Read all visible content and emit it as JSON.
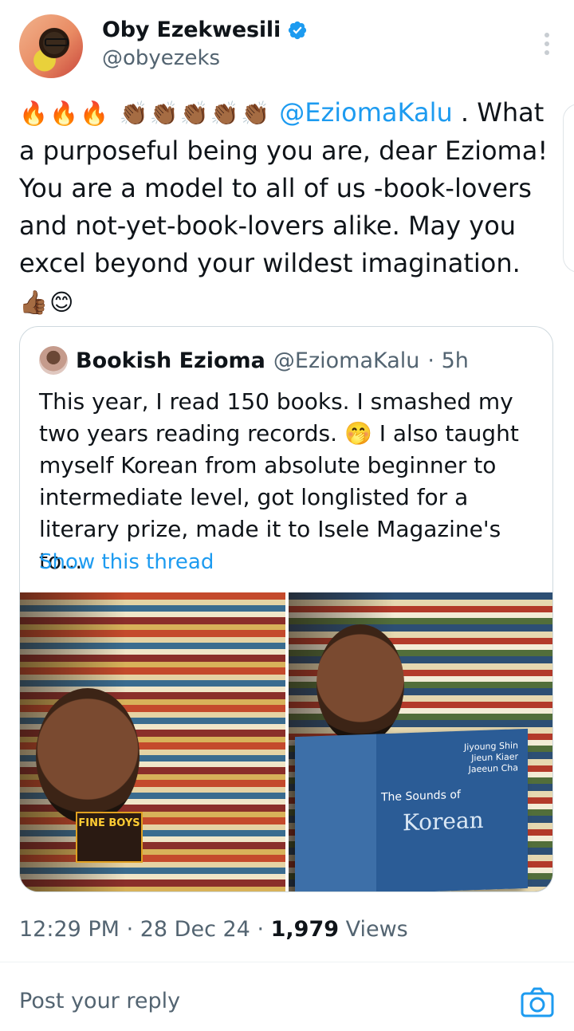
{
  "author": {
    "display_name": "Oby Ezekwesili",
    "handle": "@obyezeks"
  },
  "tweet": {
    "lead_emojis": "🔥🔥🔥 👏🏾👏🏾👏🏾👏🏾👏🏾",
    "mention": "@EziomaKalu",
    "mention_suffix": " .",
    "body": "What a purposeful being you are, dear Ezioma! You are a model to all of us -book-lovers and not-yet-book-lovers alike. May you excel beyond your wildest imagination.",
    "end_emojis": " 👍🏾😊"
  },
  "quote": {
    "name": "Bookish Ezioma",
    "handle": "@EziomaKalu",
    "time": "· 5h",
    "text": "This year, I read 150 books. I smashed my two years reading records. 🤭 I also taught myself Korean from absolute beginner to intermediate level, got longlisted for a literary prize, made it to Isele Magazine's to...",
    "show_thread": "Show this thread",
    "photo_left": {
      "book_label": "FINE BOYS"
    },
    "photo_right": {
      "book_authors": [
        "Jiyoung Shin",
        "Jieun Kiaer",
        "Jaeeun Cha"
      ],
      "book_title_a": "The Sounds of",
      "book_title_b": "Korean"
    }
  },
  "meta": {
    "time": "12:29 PM",
    "sep1": " · ",
    "date": "28 Dec 24",
    "sep2": " · ",
    "views_count": "1,979",
    "views_label": " Views"
  },
  "reply": {
    "placeholder": "Post your reply"
  },
  "colors": {
    "accent": "#1d9bf0",
    "secondary_text": "#536471",
    "border": "#cfd9de"
  },
  "icons": {
    "verified": "verified-badge-icon",
    "more": "more-vertical-icon",
    "camera": "camera-icon"
  }
}
